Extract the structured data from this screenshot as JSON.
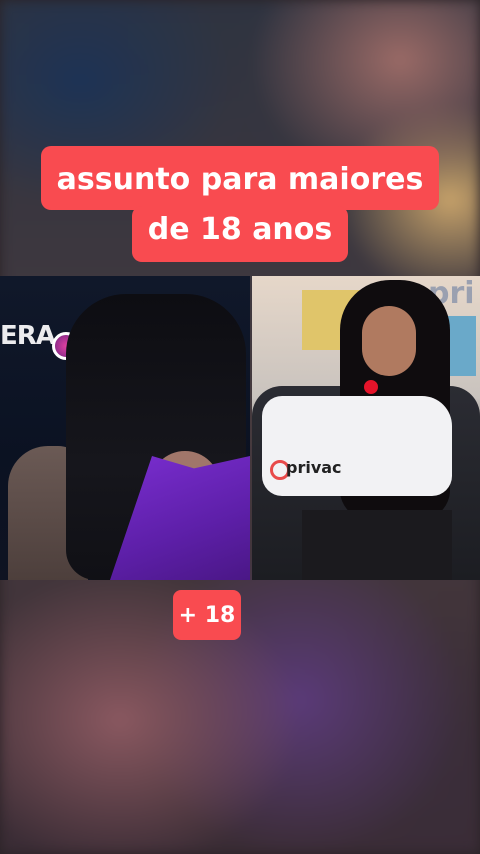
{
  "caption": {
    "line1": "assunto para maiores",
    "line2": "de 18 anos",
    "background_color": "#f94b50",
    "text_color": "#ffffff"
  },
  "panels": {
    "left": {
      "studio_logo_text": "ERA"
    },
    "right": {
      "wall_text": "pri",
      "shirt_brand_text": "privac"
    }
  },
  "badge": {
    "label": "+ 18"
  }
}
